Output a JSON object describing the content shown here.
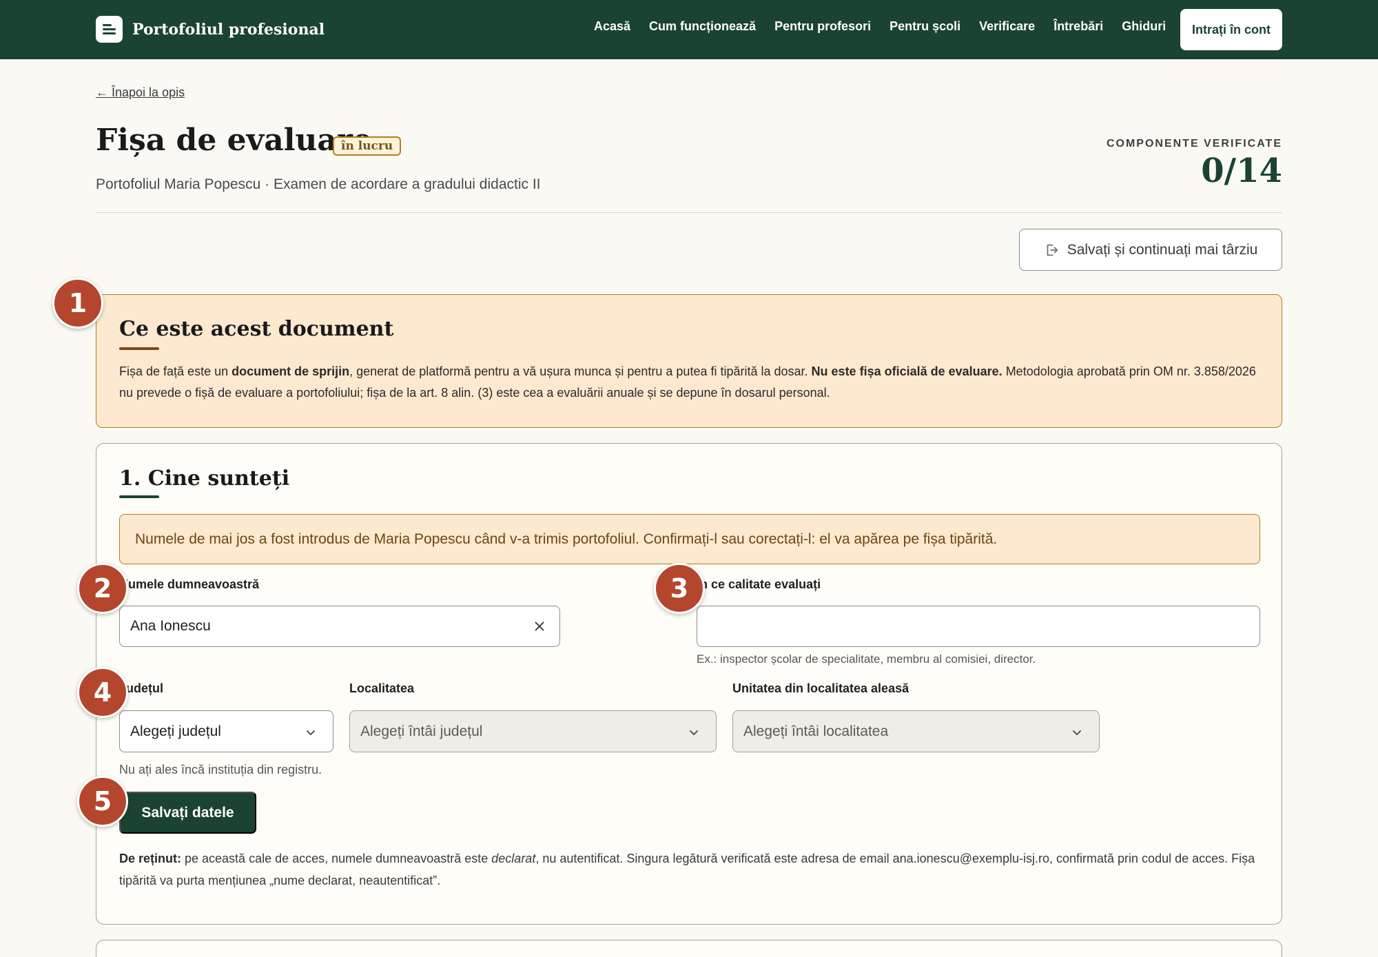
{
  "header": {
    "brand_name": "Portofoliul profesional",
    "nav": [
      "Acasă",
      "Cum funcționează",
      "Pentru profesori",
      "Pentru școli",
      "Verificare",
      "Întrebări",
      "Ghiduri"
    ],
    "login_label": "Intrați în cont"
  },
  "page": {
    "back_label": "← Înapoi la opis",
    "title": "Fișa de evaluare",
    "status": "în lucru",
    "subtitle": "Portofoliul Maria Popescu · Examen de acordare a gradului didactic II",
    "counter_label": "COMPONENTE VERIFICATE",
    "counter_value": "0/14",
    "save_later_label": "Salvați și continuați mai târziu"
  },
  "info": {
    "title": "Ce este acest document",
    "text_1": "Fișa de față este un ",
    "text_bold_1": "document de sprijin",
    "text_2": ", generat de platformă pentru a vă ușura munca și pentru a putea fi tipărită la dosar. ",
    "text_bold_2": "Nu este fișa oficială de evaluare.",
    "text_3": " Metodologia aprobată prin OM nr. 3.858/2026 nu prevede o fișă de evaluare a portofoliului; fișa de la art. 8 alin. (3) este cea a evaluării anuale și se depune în dosarul personal."
  },
  "section": {
    "title": "1. Cine sunteți",
    "notice": "Numele de mai jos a fost introdus de Maria Popescu când v-a trimis portofoliul. Confirmați-l sau corectați-l: el va apărea pe fișa tipărită.",
    "name_label": "Numele dumneavoastră",
    "name_value": "Ana Ionescu",
    "role_label": "În ce calitate evaluați",
    "role_value": "",
    "role_hint": "Ex.: inspector școlar de specialitate, membru al comisiei, director.",
    "county_label": "Județul",
    "county_value": "Alegeți județul",
    "locality_label": "Localitatea",
    "locality_value": "Alegeți întâi județul",
    "unit_label": "Unitatea din localitatea aleasă",
    "unit_value": "Alegeți întâi localitatea",
    "institution_hint": "Nu ați ales încă instituția din registru.",
    "save_label": "Salvați datele",
    "remember_bold": "De reținut:",
    "remember_1": " pe această cale de acces, numele dumneavoastră este ",
    "remember_italic": "declarat",
    "remember_2": ", nu autentificat. Singura legătură verificată este adresa de email ana.ionescu@exemplu-isj.ro, confirmată prin codul de acces. Fișa tipărită va purta mențiunea „nume declarat, neautentificat”."
  },
  "markers": [
    "1",
    "2",
    "3",
    "4",
    "5"
  ],
  "colors": {
    "brand": "#1b4332",
    "marker": "#b4462d",
    "notice_bg": "#fde8d0",
    "notice_border": "#b07d24"
  }
}
